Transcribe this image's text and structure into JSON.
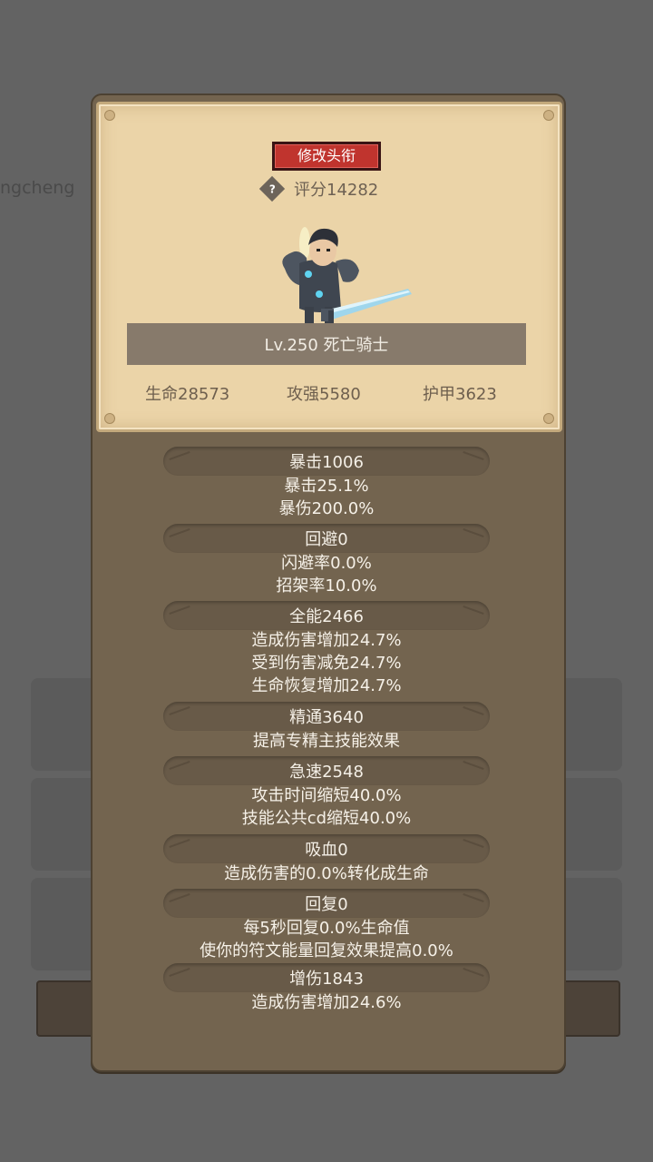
{
  "background": {
    "partial_text": "ngcheng"
  },
  "card": {
    "rename_button": "修改头衔",
    "score": "评分14282",
    "level_name": "Lv.250 死亡骑士",
    "hp": "生命28573",
    "attack": "攻强5580",
    "armor": "护甲3623"
  },
  "stats": {
    "crit": {
      "title": "暴击1006",
      "lines": [
        "暴击25.1%",
        "暴伤200.0%"
      ]
    },
    "dodge": {
      "title": "回避0",
      "lines": [
        "闪避率0.0%",
        "招架率10.0%"
      ]
    },
    "versatility": {
      "title": "全能2466",
      "lines": [
        "造成伤害增加24.7%",
        "受到伤害减免24.7%",
        "生命恢复增加24.7%"
      ]
    },
    "mastery": {
      "title": "精通3640",
      "lines": [
        "提高专精主技能效果"
      ]
    },
    "haste": {
      "title": "急速2548",
      "lines": [
        "攻击时间缩短40.0%",
        "技能公共cd缩短40.0%"
      ]
    },
    "lifesteal": {
      "title": "吸血0",
      "lines": [
        "造成伤害的0.0%转化成生命"
      ]
    },
    "regen": {
      "title": "回复0",
      "lines": [
        "每5秒回复0.0%生命值",
        "使你的符文能量回复效果提高0.0%"
      ]
    },
    "damage_bonus": {
      "title": "增伤1843",
      "lines": [
        "造成伤害增加24.6%"
      ]
    }
  },
  "colors": {
    "accent_button": "#c0342e",
    "panel": "#73644f",
    "parchment": "#ebd4a8"
  }
}
